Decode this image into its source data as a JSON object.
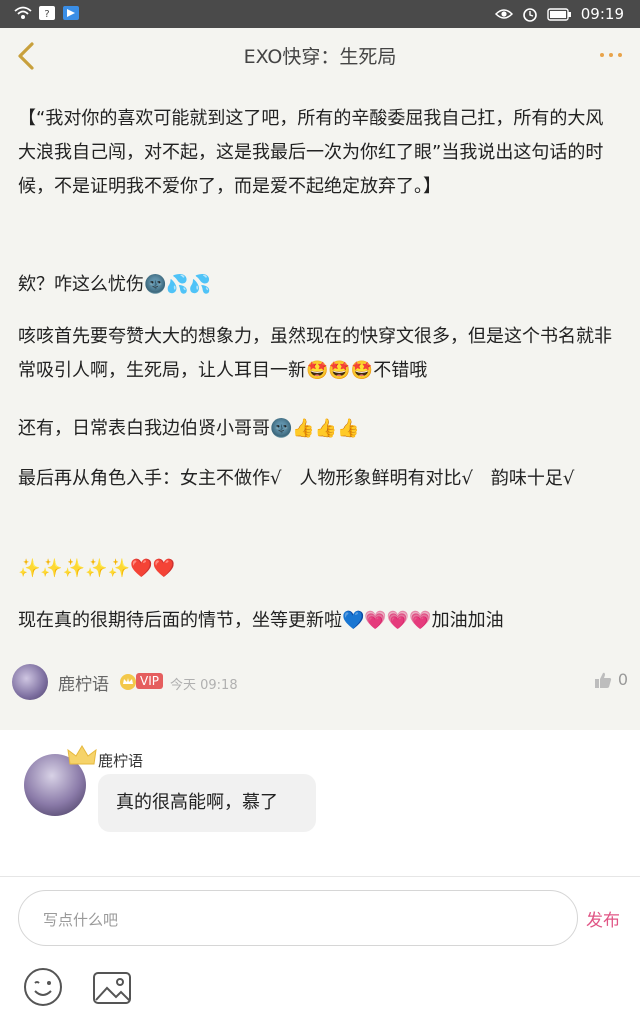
{
  "status_bar": {
    "time": "09:19"
  },
  "header": {
    "title": "EXO快穿：生死局"
  },
  "post": {
    "paragraphs": [
      "【“我对你的喜欢可能就到这了吧，所有的辛酸委屈我自己扛，所有的大风大浪我自己闯，对不起，这是我最后一次为你红了眼”当我说出这句话的时候，不是证明我不爱你了，而是爱不起绝定放弃了。】",
      "欸？咋这么忧伤🌚💦💦",
      "咳咳首先要夸赞大大的想象力，虽然现在的快穿文很多，但是这个书名就非常吸引人啊，生死局，让人耳目一新🤩🤩🤩不错哦",
      "还有，日常表白我边伯贤小哥哥🌚👍👍👍",
      "最后再从角色入手：女主不做作√　人物形象鲜明有对比√　韵味十足√",
      "✨✨✨✨✨❤️❤️",
      "现在真的很期待后面的情节，坐等更新啦💙💗💗💗加油加油"
    ],
    "author": "鹿柠语",
    "vip_label": "VIP",
    "time": "今天 09:18",
    "likes": "0"
  },
  "reply": {
    "author": "鹿柠语",
    "text": "真的很高能啊，慕了"
  },
  "composer": {
    "placeholder": "写点什么吧",
    "publish_label": "发布"
  },
  "colors": {
    "accent": "#e05585",
    "back_arrow": "#c8a03c",
    "post_bg": "#f4f4f0",
    "vip": "#e55e5e"
  },
  "icons": [
    "wifi-icon",
    "back-icon",
    "more-icon",
    "eye-icon",
    "alarm-icon",
    "battery-icon",
    "thumbs-up-icon",
    "crown-icon",
    "smile-icon",
    "image-icon"
  ]
}
